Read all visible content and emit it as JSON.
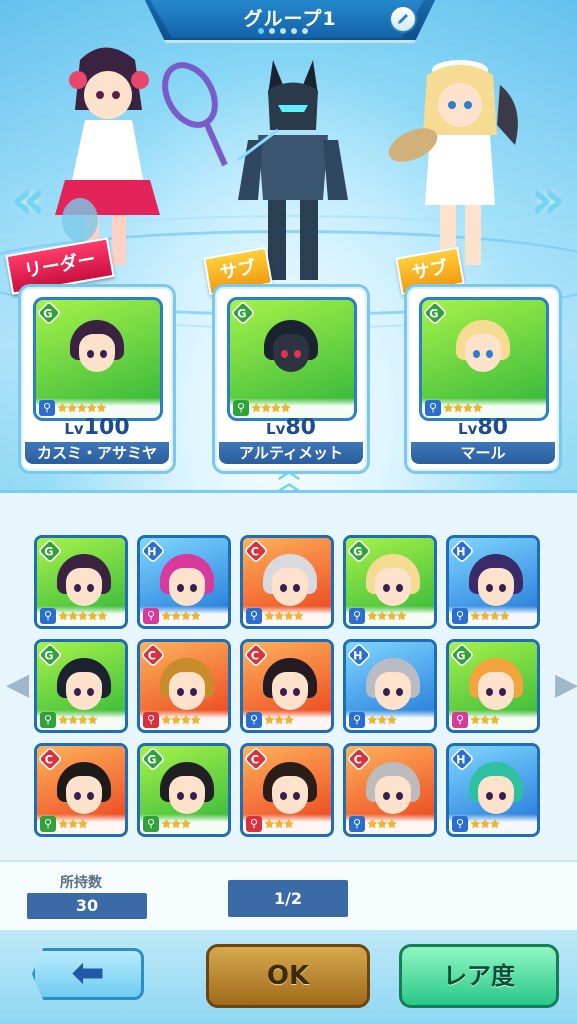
{
  "header": {
    "title": "グループ1",
    "page_dots": [
      true,
      false,
      false,
      false,
      false
    ]
  },
  "icons": {
    "edit": "pencil-icon",
    "prev": "double-chevron-left-icon",
    "next": "double-chevron-right-icon",
    "back": "arrow-left-icon"
  },
  "team": {
    "leader_label": "リーダー",
    "sub_label": "サブ",
    "members": [
      {
        "role": "leader",
        "rank": "G",
        "lv_prefix": "Lv",
        "lv": "100",
        "name": "カスミ・アサミヤ",
        "stars": "★★★★★",
        "hair": "#3a2340"
      },
      {
        "role": "sub",
        "rank": "G",
        "lv_prefix": "Lv",
        "lv": "80",
        "name": "アルティメット",
        "stars": "★★★★",
        "hair": "#1b2230"
      },
      {
        "role": "sub",
        "rank": "G",
        "lv_prefix": "Lv",
        "lv": "80",
        "name": "マール",
        "stars": "★★★★",
        "hair": "#f6dc93"
      }
    ]
  },
  "roster": [
    {
      "rank": "G",
      "stars": "★★★★★",
      "hair": "#3a2340"
    },
    {
      "rank": "H",
      "stars": "★★★★",
      "hair": "#d7399c"
    },
    {
      "rank": "C",
      "stars": "★★★★",
      "hair": "#d9d9de"
    },
    {
      "rank": "G",
      "stars": "★★★★",
      "hair": "#f6dc93"
    },
    {
      "rank": "H",
      "stars": "★★★★",
      "hair": "#3a2a6a"
    },
    {
      "rank": "G",
      "stars": "★★★★",
      "hair": "#1b2230"
    },
    {
      "rank": "C",
      "stars": "★★★★",
      "hair": "#c98c2a"
    },
    {
      "rank": "C",
      "stars": "★★★",
      "hair": "#231a22"
    },
    {
      "rank": "H",
      "stars": "★★★",
      "hair": "#b9bcc4"
    },
    {
      "rank": "G",
      "stars": "★★★",
      "hair": "#f4a43c"
    },
    {
      "rank": "C",
      "stars": "★★★",
      "hair": "#1f1a1a"
    },
    {
      "rank": "G",
      "stars": "★★★",
      "hair": "#202024"
    },
    {
      "rank": "C",
      "stars": "★★★",
      "hair": "#2b1c18"
    },
    {
      "rank": "C",
      "stars": "★★★",
      "hair": "#bcbcbc"
    },
    {
      "rank": "H",
      "stars": "★★★",
      "hair": "#2fbfa2"
    }
  ],
  "footer": {
    "owned_label": "所持数",
    "owned_count": "30",
    "page": "1/2",
    "ok_label": "OK",
    "rarity_label": "レア度"
  },
  "colors": {
    "accent": "#2b7fc7",
    "G": "#2fa23a",
    "H": "#2a6ed0",
    "C": "#d8323f"
  }
}
